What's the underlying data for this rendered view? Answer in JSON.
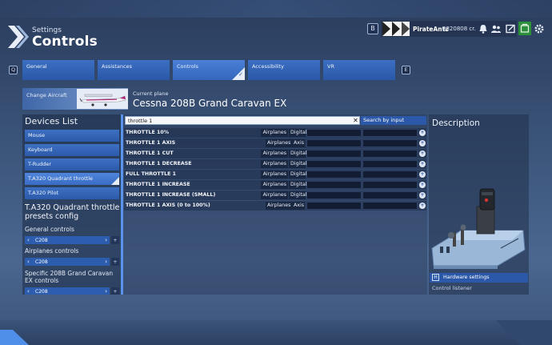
{
  "header": {
    "section": "Settings",
    "title": "Controls"
  },
  "topbar": {
    "b_key": "B",
    "username": "PirateAntz",
    "credits": "4320808 cr."
  },
  "tabs": {
    "prev_key": "Q",
    "next_key": "E",
    "items": [
      {
        "label": "General"
      },
      {
        "label": "Assistances"
      },
      {
        "label": "Controls"
      },
      {
        "label": "Accessibility"
      },
      {
        "label": "VR"
      }
    ]
  },
  "plane": {
    "change_label": "Change Aircraft",
    "current_label": "Current plane",
    "name": "Cessna 208B Grand Caravan EX"
  },
  "devices": {
    "title": "Devices List",
    "items": [
      {
        "label": "Mouse"
      },
      {
        "label": "Keyboard"
      },
      {
        "label": "T-Rudder"
      },
      {
        "label": "T.A320 Quadrant throttle"
      },
      {
        "label": "T.A320 Pilot"
      }
    ],
    "config_title": "T.A320 Quadrant throttle presets config",
    "general_label": "General controls",
    "general_value": "C208",
    "airplanes_label": "Airplanes controls",
    "airplanes_value": "C208",
    "specific_label": "Specific 208B Grand Caravan EX controls",
    "specific_value": "C208"
  },
  "search": {
    "value": "throttle 1",
    "button": "Search by input"
  },
  "bindings": [
    {
      "name": "THROTTLE 10%",
      "category": "Airplanes",
      "type": "Digital"
    },
    {
      "name": "THROTTLE 1 AXIS",
      "category": "Airplanes",
      "type": "Axis"
    },
    {
      "name": "THROTTLE 1 CUT",
      "category": "Airplanes",
      "type": "Digital"
    },
    {
      "name": "THROTTLE 1 DECREASE",
      "category": "Airplanes",
      "type": "Digital"
    },
    {
      "name": "FULL THROTTLE 1",
      "category": "Airplanes",
      "type": "Digital"
    },
    {
      "name": "THROTTLE 1 INCREASE",
      "category": "Airplanes",
      "type": "Digital"
    },
    {
      "name": "THROTTLE 1 INCREASE (SMALL)",
      "category": "Airplanes",
      "type": "Digital"
    },
    {
      "name": "THROTTLE 1 AXIS (0 to 100%)",
      "category": "Airplanes",
      "type": "Axis"
    }
  ],
  "description": {
    "title": "Description",
    "hardware_key": "H",
    "hardware_label": "Hardware settings",
    "listener": "Control listener"
  },
  "colors": {
    "accent": "#2b58a8",
    "active_tab": "#3466bd",
    "status_green": "#2e8f3a"
  },
  "icons": [
    "chevron-logo-icon",
    "bell-icon",
    "friends-icon",
    "message-icon",
    "shop-icon",
    "gear-icon",
    "close-icon",
    "plus-icon",
    "arrow-left-icon",
    "arrow-right-icon",
    "check-icon"
  ]
}
